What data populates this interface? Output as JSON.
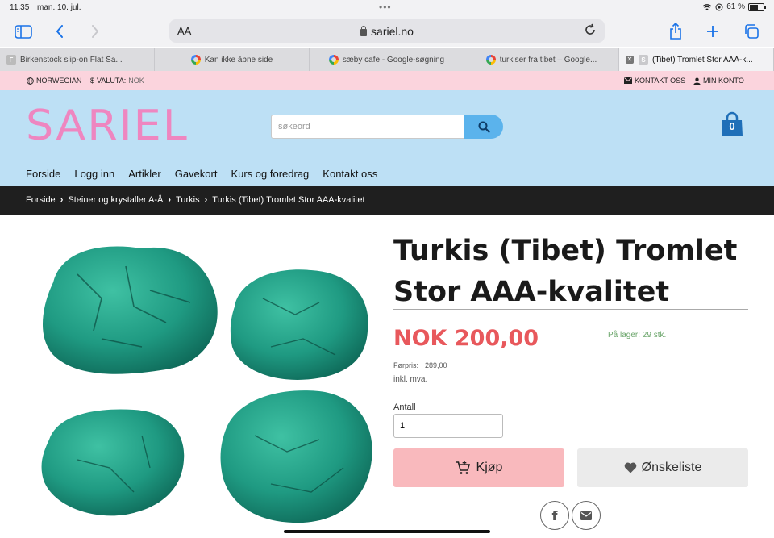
{
  "status_bar": {
    "time": "11.35",
    "date": "man. 10. jul.",
    "battery": "61 %"
  },
  "browser": {
    "text_size_label": "AA",
    "url": "sariel.no",
    "tabs": [
      {
        "label": "Birkenstock slip-on Flat Sa...",
        "favicon": "F"
      },
      {
        "label": "Kan ikke åbne side",
        "favicon": "google-icon"
      },
      {
        "label": "sæby cafe - Google-søgning",
        "favicon": "google-icon"
      },
      {
        "label": "turkiser fra tibet – Google...",
        "favicon": "google-icon"
      },
      {
        "label": "(Tibet) Tromlet Stor AAA-k...",
        "favicon": "S",
        "active": true
      }
    ]
  },
  "topbar": {
    "language": "NORWEGIAN",
    "currency_label": "VALUTA:",
    "currency_value": "NOK",
    "contact": "KONTAKT OSS",
    "account": "MIN KONTO"
  },
  "header": {
    "logo": "SARIEL",
    "search_placeholder": "søkeord",
    "cart_count": "0",
    "nav": [
      "Forside",
      "Logg inn",
      "Artikler",
      "Gavekort",
      "Kurs og foredrag",
      "Kontakt oss"
    ]
  },
  "breadcrumb": [
    "Forside",
    "Steiner og krystaller A-Å",
    "Turkis",
    "Turkis (Tibet) Tromlet Stor AAA-kvalitet"
  ],
  "product": {
    "title": "Turkis (Tibet) Tromlet Stor AAA-kvalitet",
    "price": "NOK 200,00",
    "stock": "På lager: 29 stk.",
    "previous_price_label": "Førpris:",
    "previous_price": "289,00",
    "vat_note": "inkl. mva.",
    "quantity_label": "Antall",
    "quantity_value": "1",
    "buy_label": "Kjøp",
    "wishlist_label": "Ønskeliste"
  },
  "colors": {
    "accent_pink": "#fbd4dd",
    "header_blue": "#bde0f5",
    "logo_pink": "#ee86c0",
    "price_red": "#e8585c",
    "stone_green": "#1f9a82"
  }
}
